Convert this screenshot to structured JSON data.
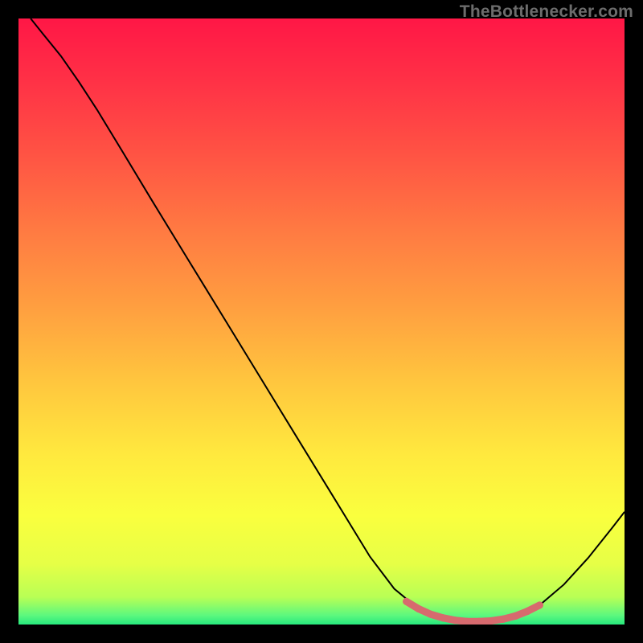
{
  "attribution": "TheBottlenecker.com",
  "chart_data": {
    "type": "line",
    "title": "",
    "xlabel": "",
    "ylabel": "",
    "xlim": [
      0,
      100
    ],
    "ylim": [
      0,
      100
    ],
    "background_gradient": {
      "stops": [
        {
          "offset": 0.0,
          "color": "#ff1746"
        },
        {
          "offset": 0.1,
          "color": "#ff3046"
        },
        {
          "offset": 0.22,
          "color": "#ff5244"
        },
        {
          "offset": 0.35,
          "color": "#ff7a42"
        },
        {
          "offset": 0.48,
          "color": "#ffa040"
        },
        {
          "offset": 0.6,
          "color": "#ffc63e"
        },
        {
          "offset": 0.72,
          "color": "#ffe93e"
        },
        {
          "offset": 0.82,
          "color": "#faff3e"
        },
        {
          "offset": 0.9,
          "color": "#e6ff46"
        },
        {
          "offset": 0.955,
          "color": "#b8ff55"
        },
        {
          "offset": 0.985,
          "color": "#5cf87e"
        },
        {
          "offset": 1.0,
          "color": "#27e87d"
        }
      ]
    },
    "series": [
      {
        "name": "bottleneck-curve",
        "stroke": "#000000",
        "stroke_width": 2,
        "data": [
          {
            "x": 2.0,
            "y": 100.0
          },
          {
            "x": 4.0,
            "y": 97.5
          },
          {
            "x": 7.0,
            "y": 93.8
          },
          {
            "x": 10.0,
            "y": 89.5
          },
          {
            "x": 13.0,
            "y": 84.9
          },
          {
            "x": 17.0,
            "y": 78.3
          },
          {
            "x": 22.0,
            "y": 70.0
          },
          {
            "x": 28.0,
            "y": 60.2
          },
          {
            "x": 34.0,
            "y": 50.4
          },
          {
            "x": 40.0,
            "y": 40.6
          },
          {
            "x": 46.0,
            "y": 30.8
          },
          {
            "x": 52.0,
            "y": 21.0
          },
          {
            "x": 58.0,
            "y": 11.2
          },
          {
            "x": 62.0,
            "y": 5.9
          },
          {
            "x": 66.0,
            "y": 2.6
          },
          {
            "x": 70.0,
            "y": 1.1
          },
          {
            "x": 74.0,
            "y": 0.5
          },
          {
            "x": 78.0,
            "y": 0.6
          },
          {
            "x": 82.0,
            "y": 1.4
          },
          {
            "x": 86.0,
            "y": 3.2
          },
          {
            "x": 90.0,
            "y": 6.6
          },
          {
            "x": 94.0,
            "y": 11.0
          },
          {
            "x": 98.0,
            "y": 16.0
          },
          {
            "x": 100.0,
            "y": 18.6
          }
        ]
      },
      {
        "name": "optimal-zone-marker",
        "stroke": "#d76a6e",
        "stroke_width": 9,
        "linecap": "round",
        "data": [
          {
            "x": 64.0,
            "y": 3.8
          },
          {
            "x": 66.0,
            "y": 2.6
          },
          {
            "x": 68.0,
            "y": 1.7
          },
          {
            "x": 70.0,
            "y": 1.1
          },
          {
            "x": 72.0,
            "y": 0.7
          },
          {
            "x": 74.0,
            "y": 0.5
          },
          {
            "x": 76.0,
            "y": 0.5
          },
          {
            "x": 78.0,
            "y": 0.6
          },
          {
            "x": 80.0,
            "y": 0.9
          },
          {
            "x": 82.0,
            "y": 1.4
          },
          {
            "x": 84.0,
            "y": 2.2
          },
          {
            "x": 86.0,
            "y": 3.2
          }
        ]
      }
    ]
  }
}
